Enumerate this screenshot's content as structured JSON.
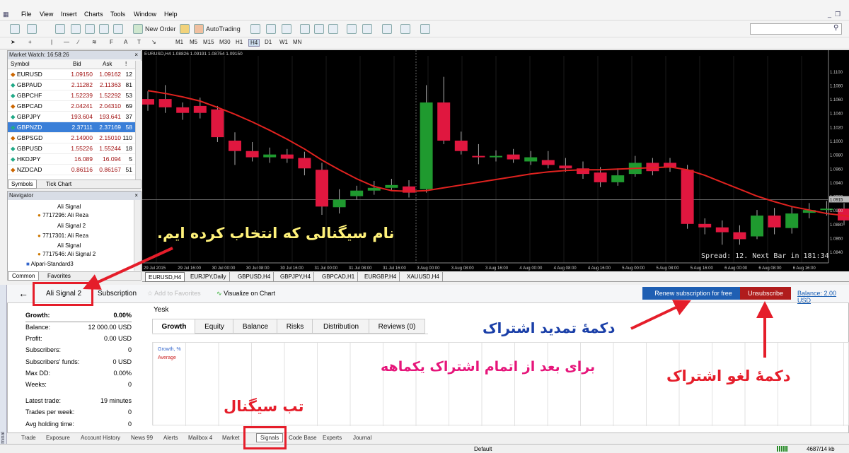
{
  "menu": {
    "items": [
      "File",
      "View",
      "Insert",
      "Charts",
      "Tools",
      "Window",
      "Help"
    ]
  },
  "toolbar": {
    "new_order": "New Order",
    "auto_trading": "AutoTrading",
    "timeframes": [
      "M1",
      "M5",
      "M15",
      "M30",
      "H1",
      "H4",
      "D1",
      "W1",
      "MN"
    ]
  },
  "market_watch": {
    "title": "Market Watch: 16:58:26",
    "col_symbol": "Symbol",
    "col_bid": "Bid",
    "col_ask": "Ask",
    "col_spread": "!",
    "rows": [
      {
        "symbol": "EURUSD",
        "bid": "1.09150",
        "ask": "1.09162",
        "spread": "12"
      },
      {
        "symbol": "GBPAUD",
        "bid": "2.11282",
        "ask": "2.11363",
        "spread": "81"
      },
      {
        "symbol": "GBPCHF",
        "bid": "1.52239",
        "ask": "1.52292",
        "spread": "53"
      },
      {
        "symbol": "GBPCAD",
        "bid": "2.04241",
        "ask": "2.04310",
        "spread": "69"
      },
      {
        "symbol": "GBPJPY",
        "bid": "193.604",
        "ask": "193.641",
        "spread": "37"
      },
      {
        "symbol": "GBPNZD",
        "bid": "2.37111",
        "ask": "2.37169",
        "spread": "58"
      },
      {
        "symbol": "GBPSGD",
        "bid": "2.14900",
        "ask": "2.15010",
        "spread": "110"
      },
      {
        "symbol": "GBPUSD",
        "bid": "1.55226",
        "ask": "1.55244",
        "spread": "18"
      },
      {
        "symbol": "HKDJPY",
        "bid": "16.089",
        "ask": "16.094",
        "spread": "5"
      },
      {
        "symbol": "NZDCAD",
        "bid": "0.86116",
        "ask": "0.86167",
        "spread": "51"
      }
    ],
    "tabs": [
      "Symbols",
      "Tick Chart"
    ]
  },
  "navigator": {
    "title": "Navigator",
    "items": [
      "Ali Signal",
      "7717296: Ali Reza",
      "Ali Signal 2",
      "7717301: Ali Reza",
      "Ali Signal",
      "7717546: Ali Signal 2",
      "Alpari-Standard3"
    ],
    "tabs": [
      "Common",
      "Favorites"
    ]
  },
  "chart": {
    "header": "EURUSD,H4  1.08826 1.09191 1.08754 1.09150",
    "spread_text": "Spread: 12. Next Bar in 181:34",
    "price_labels": [
      "1.1100",
      "1.1080",
      "1.1060",
      "1.1040",
      "1.1020",
      "1.1000",
      "1.0980",
      "1.0960",
      "1.0940",
      "1.0920",
      "1.0900",
      "1.0880",
      "1.0860",
      "1.0840"
    ],
    "current_price": "1.0915",
    "time_labels": [
      "29 Jul 2015",
      "29 Jul 16:00",
      "30 Jul 00:00",
      "30 Jul 08:00",
      "30 Jul 16:00",
      "31 Jul 00:00",
      "31 Jul 08:00",
      "31 Jul 16:00",
      "3 Aug 00:00",
      "3 Aug 08:00",
      "3 Aug 16:00",
      "4 Aug 00:00",
      "4 Aug 08:00",
      "4 Aug 16:00",
      "5 Aug 00:00",
      "5 Aug 08:00",
      "5 Aug 16:00",
      "6 Aug 00:00",
      "6 Aug 08:00",
      "6 Aug 16:00"
    ],
    "up_color": "#1f9a2f",
    "down_color": "#e0173f",
    "tabs": [
      "EURUSD,H4",
      "EURJPY,Daily",
      "GBPUSD,H4",
      "GBPJPY,H4",
      "GBPCAD,H1",
      "EURGBP,H4",
      "XAUUSD,H4"
    ]
  },
  "signal": {
    "name_tab": "Ali Signal 2",
    "subscription_tab": "Subscription",
    "add_favorites": "Add to Favorites",
    "visualize": "Visualize on Chart",
    "renew_button": "Renew subscription for free",
    "unsubscribe_button": "Unsubscribe",
    "balance_link": "Balance: 2.00 USD",
    "owner": "Yesk",
    "stats": [
      {
        "label": "Growth:",
        "value": "0.00%"
      },
      {
        "label": "Balance:",
        "value": "12 000.00 USD"
      },
      {
        "label": "Profit:",
        "value": "0.00 USD"
      },
      {
        "label": "Subscribers:",
        "value": "0"
      },
      {
        "label": "Subscribers' funds:",
        "value": "0 USD"
      },
      {
        "label": "Max DD:",
        "value": "0.00%"
      },
      {
        "label": "Weeks:",
        "value": "0"
      },
      {
        "label": "Latest trade:",
        "value": "19 minutes"
      },
      {
        "label": "Trades per week:",
        "value": "0"
      },
      {
        "label": "Avg holding time:",
        "value": "0"
      }
    ],
    "graph_tabs": [
      "Growth",
      "Equity",
      "Balance",
      "Risks",
      "Distribution",
      "Reviews (0)"
    ],
    "legend_growth": "Growth, %",
    "legend_average": "Average"
  },
  "bottom_tabs": [
    "Trade",
    "Exposure",
    "Account History",
    "News 99",
    "Alerts",
    "Mailbox 4",
    "Market",
    "Signals",
    "Code Base",
    "Experts",
    "Journal"
  ],
  "terminal_label": "Terminal",
  "status": {
    "profile": "Default",
    "traffic": "4687/14 kb"
  },
  "annotations": {
    "signal_name": "نام سیگنالی که انتخاب کرده ایم.",
    "renew": "دکمۀ تمدید اشتراک",
    "renew_note": "برای بعد از اتمام اشتراک یکماهه",
    "cancel": "دکمۀ لغو اشتراک",
    "signals_tab": "تب سیگنال"
  }
}
